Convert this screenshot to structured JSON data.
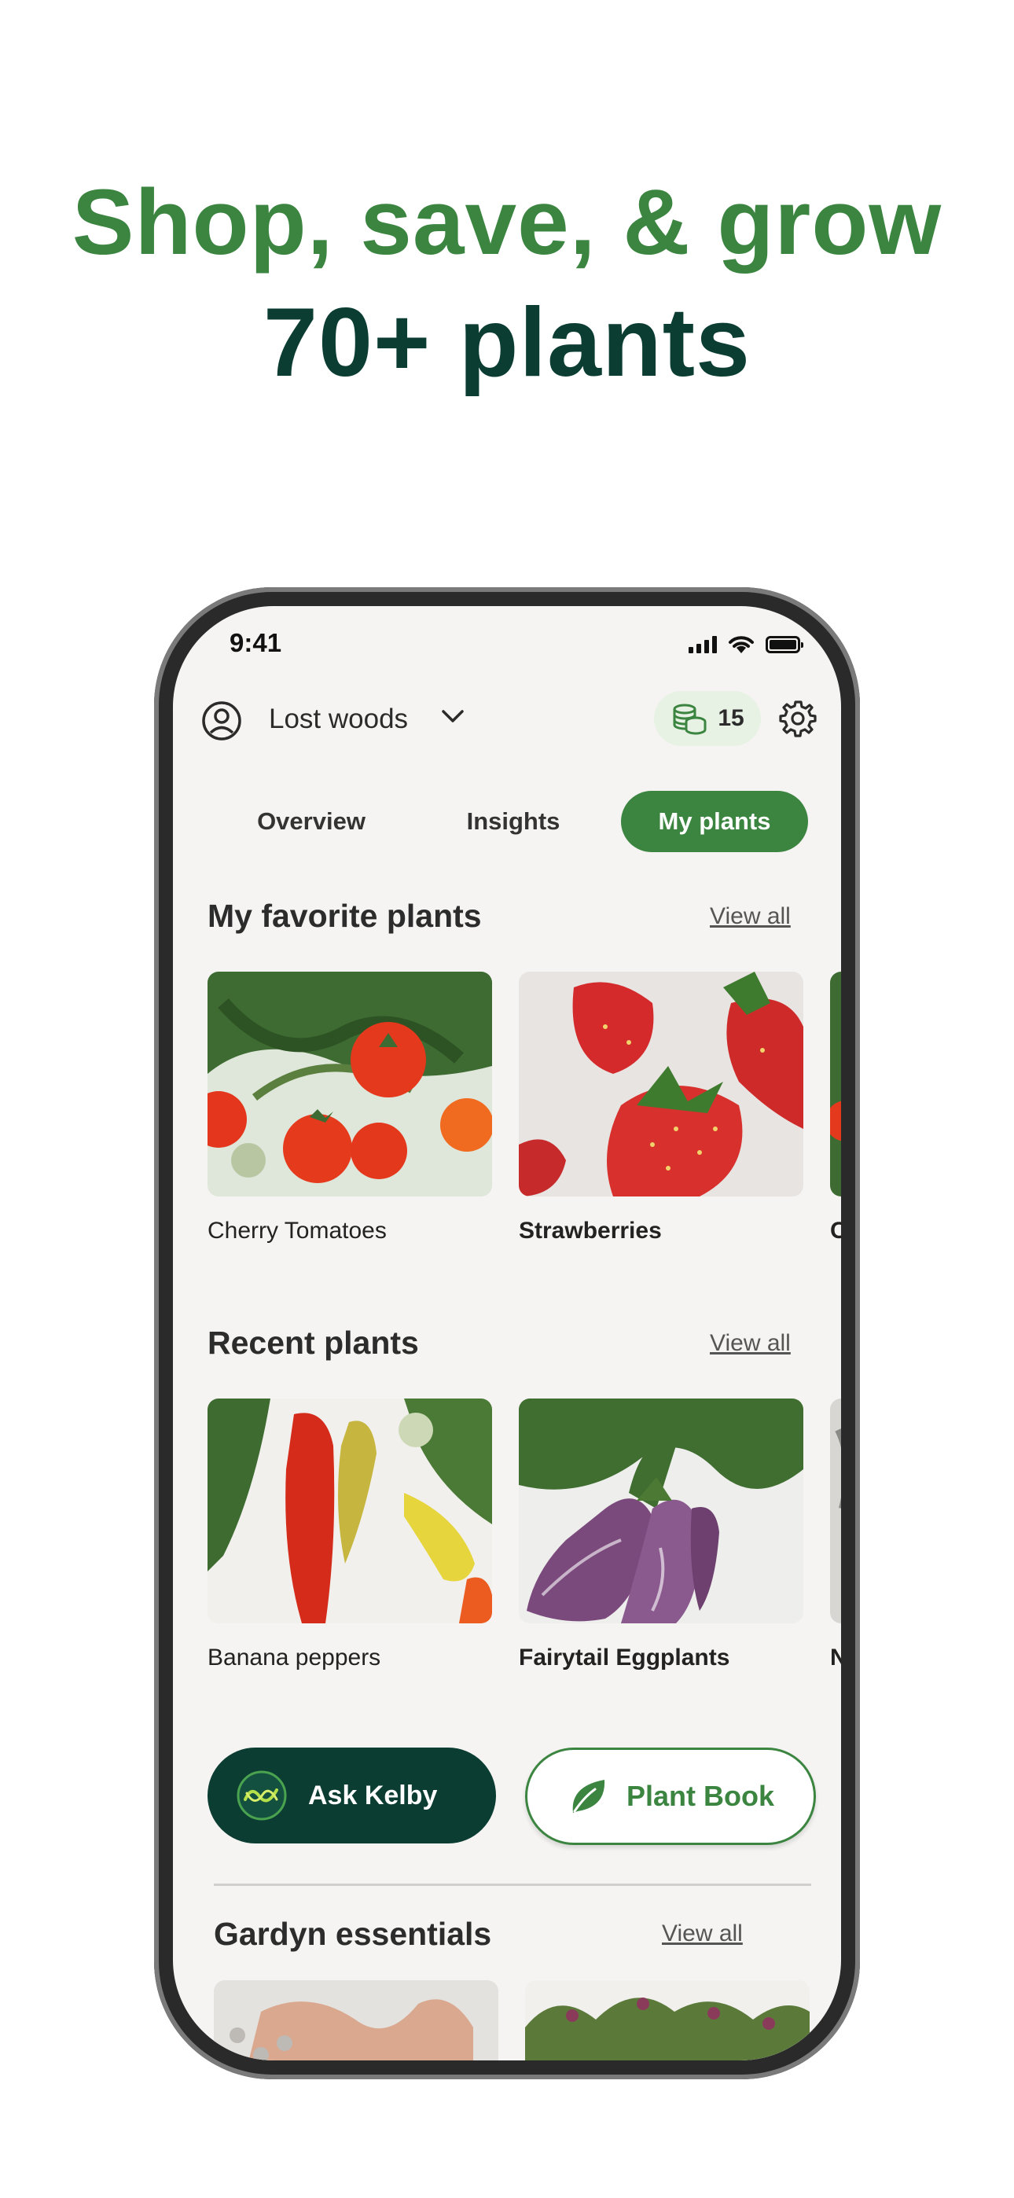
{
  "headline": {
    "line1": "Shop, save, & grow",
    "line2": "70+ plants"
  },
  "status_bar": {
    "time": "9:41"
  },
  "header": {
    "garden_name": "Lost woods",
    "coin_count": "15"
  },
  "tabs": [
    {
      "label": "Overview",
      "active": false
    },
    {
      "label": "Insights",
      "active": false
    },
    {
      "label": "My plants",
      "active": true
    }
  ],
  "favorites": {
    "title": "My favorite plants",
    "view_all": "View all",
    "items": [
      {
        "label": "Cherry Tomatoes"
      },
      {
        "label": "Strawberries"
      },
      {
        "label": "C"
      }
    ]
  },
  "recent": {
    "title": "Recent plants",
    "view_all": "View all",
    "items": [
      {
        "label": "Banana peppers"
      },
      {
        "label": "Fairytail Eggplants"
      },
      {
        "label": "N"
      }
    ]
  },
  "actions": {
    "ask": "Ask Kelby",
    "book": "Plant Book"
  },
  "essentials": {
    "title": "Gardyn essentials",
    "view_all": "View all"
  },
  "colors": {
    "brand_green": "#3b8541",
    "dark_green": "#0b3d33",
    "screen_bg": "#f5f4f2"
  }
}
